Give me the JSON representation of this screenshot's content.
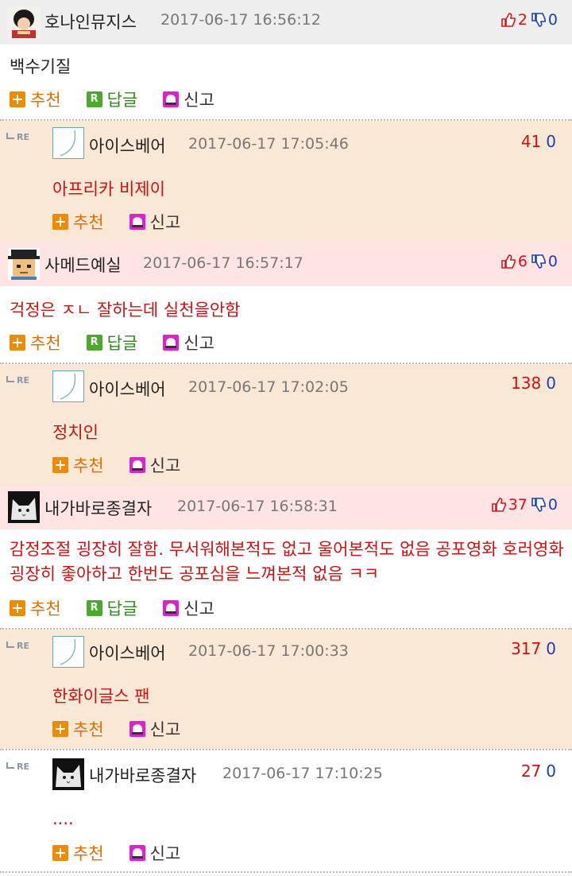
{
  "actions": {
    "recommend": "추천",
    "reply": "답글",
    "report": "신고",
    "reply_icon_letter": "R"
  },
  "re_label": "RE",
  "colors": {
    "header_gray": "#eeeeee",
    "header_pink": "#ffe4e4",
    "reply_bg": "#fae8d6",
    "upvote": "#e01010",
    "downvote": "#1a3fb0",
    "recommend_accent": "#f08a00",
    "reply_accent": "#4caa2a",
    "report_accent": "#e020d0"
  },
  "comments": [
    {
      "nickname": "호나인뮤지스",
      "date": "2017-06-17 16:56:12",
      "up": "2",
      "down": "0",
      "text": "백수기질",
      "reply": {
        "nickname": "아이스베어",
        "date": "2017-06-17 17:05:46",
        "up": "41",
        "down": "0",
        "text": "아프리카 비제이"
      }
    },
    {
      "nickname": "사메드예실",
      "date": "2017-06-17 16:57:17",
      "up": "6",
      "down": "0",
      "text": "걱정은 ㅈㄴ 잘하는데 실천을안함",
      "reply": {
        "nickname": "아이스베어",
        "date": "2017-06-17 17:02:05",
        "up": "138",
        "down": "0",
        "text": "정치인"
      }
    },
    {
      "nickname": "내가바로종결자",
      "date": "2017-06-17 16:58:31",
      "up": "37",
      "down": "0",
      "text": "감정조절 굉장히 잘함. 무서워해본적도 없고 울어본적도 없음 공포영화 호러영화 굉장히 좋아하고 한번도 공포심을 느껴본적 없음 ㅋㅋ",
      "replies": [
        {
          "nickname": "아이스베어",
          "date": "2017-06-17 17:00:33",
          "up": "317",
          "down": "0",
          "text": "한화이글스 팬"
        },
        {
          "nickname": "내가바로종결자",
          "date": "2017-06-17 17:10:25",
          "up": "27",
          "down": "0",
          "text": "...."
        }
      ]
    }
  ]
}
